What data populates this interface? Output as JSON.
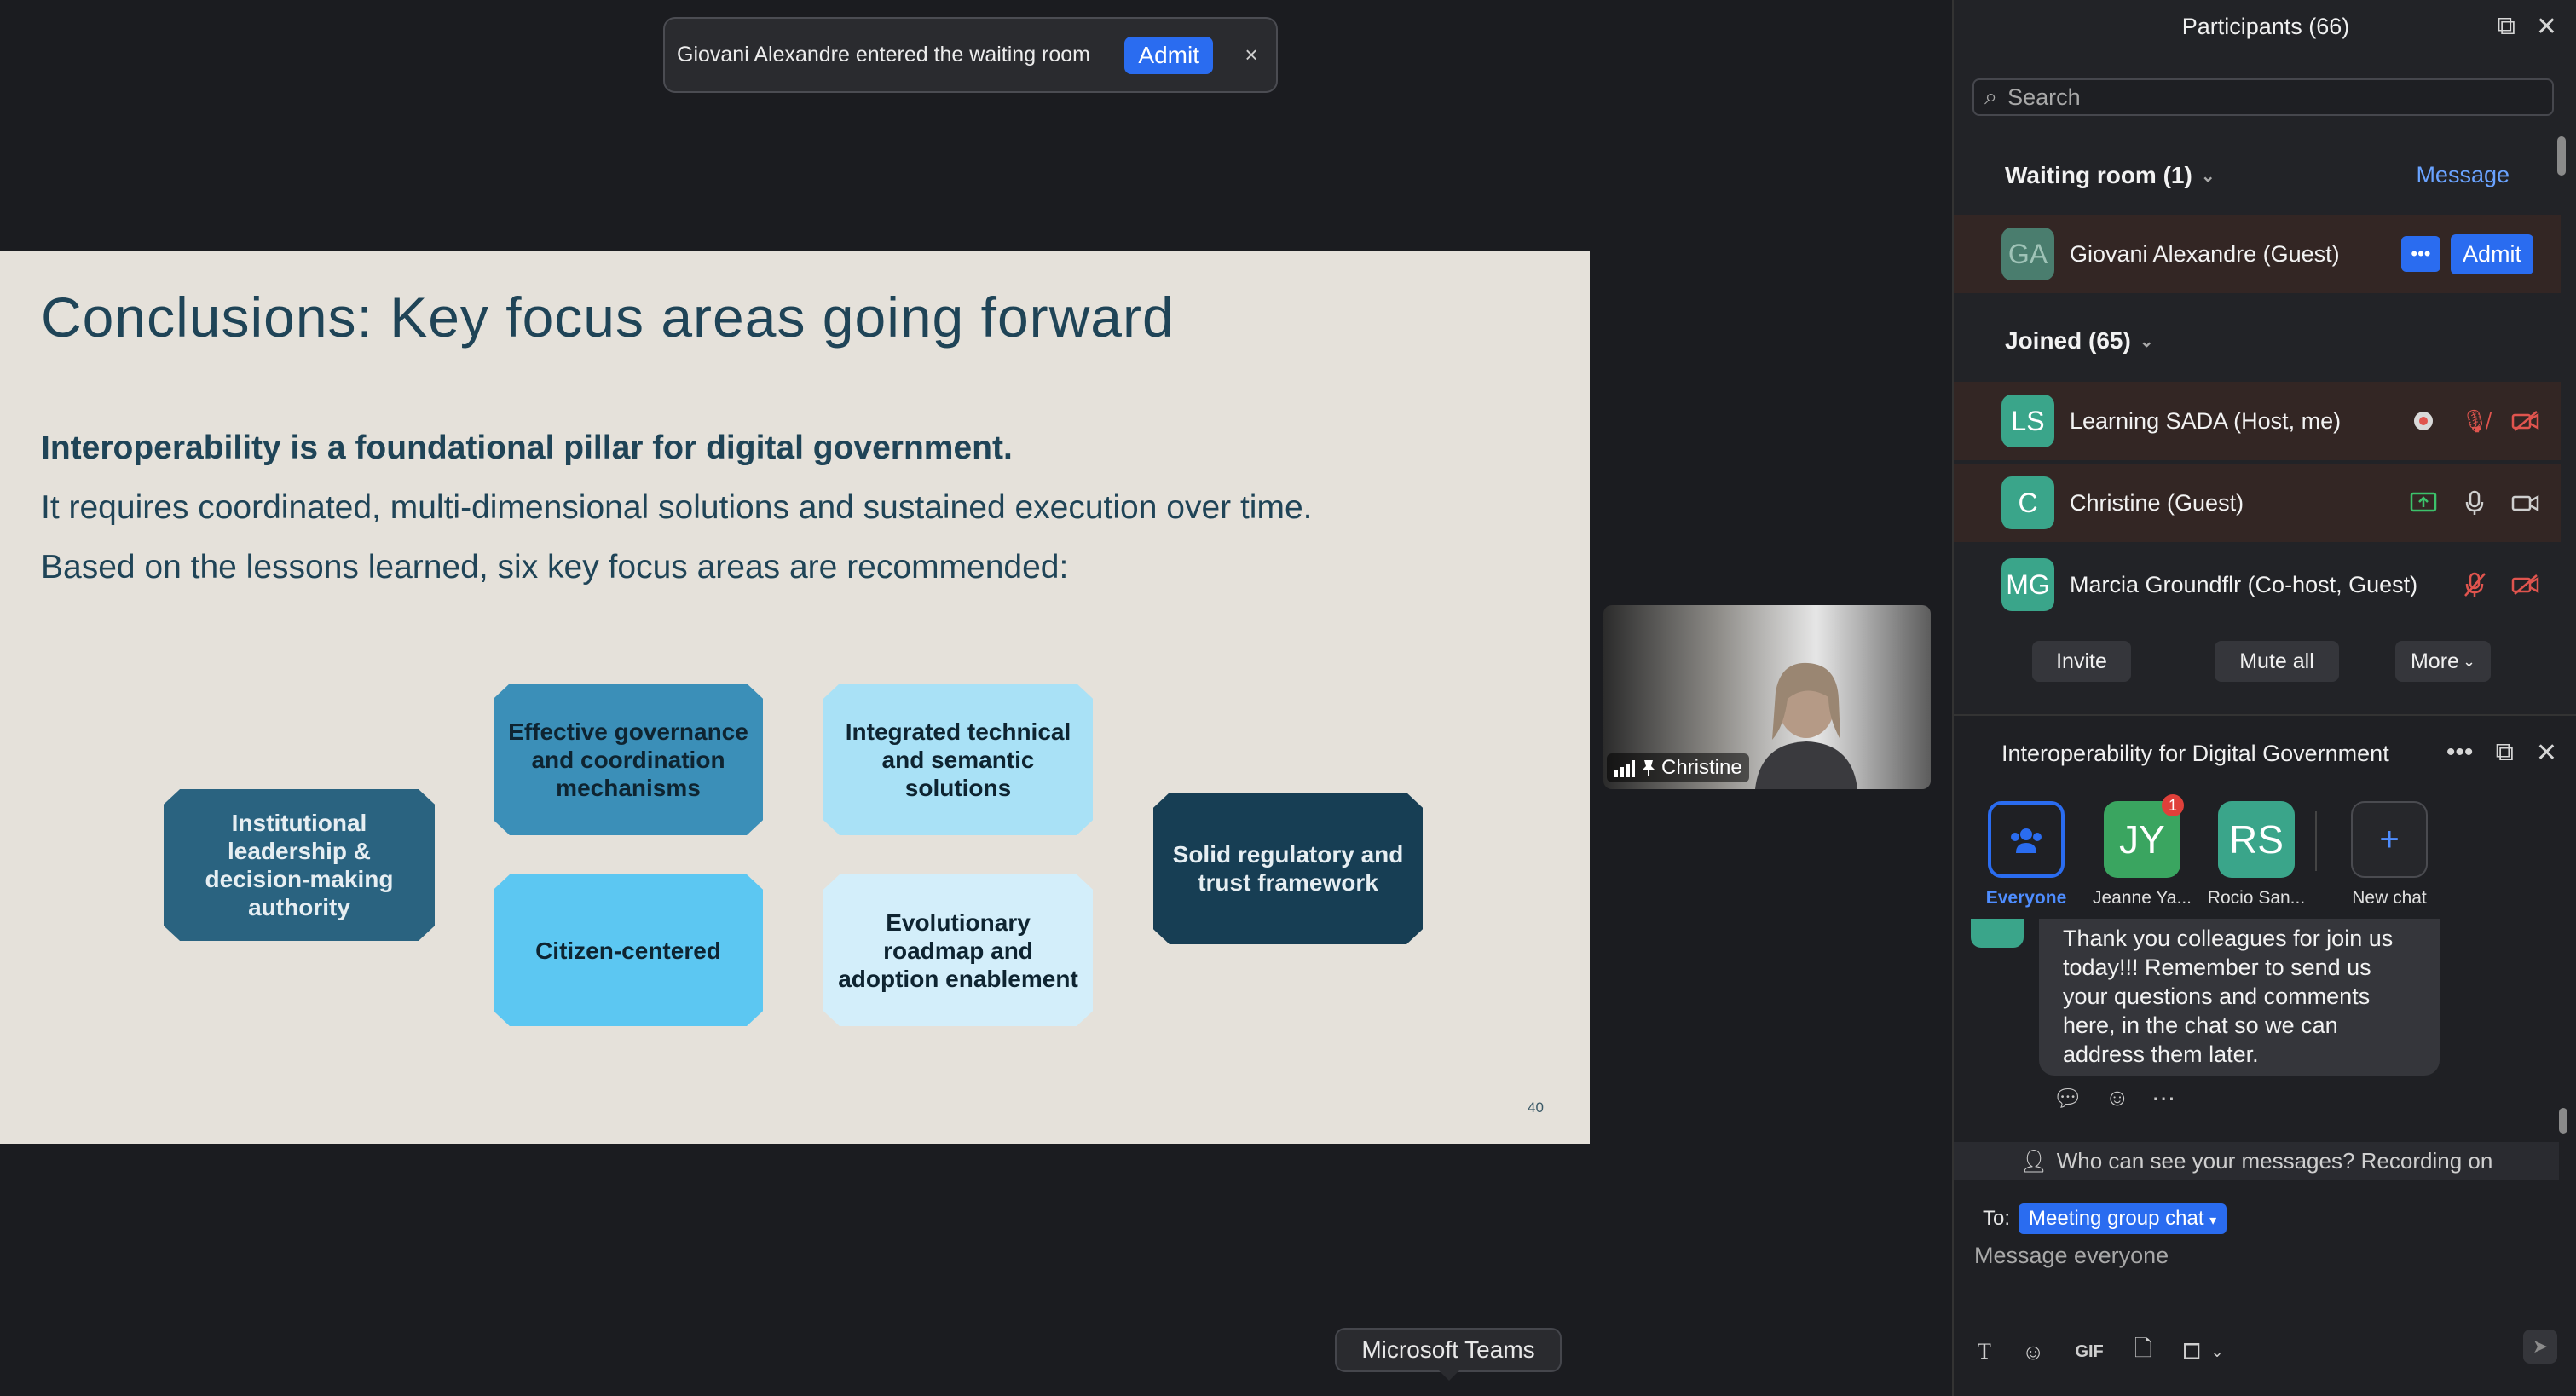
{
  "toast": {
    "message": "Giovani Alexandre entered the waiting room",
    "admit_label": "Admit",
    "close_glyph": "×"
  },
  "slide": {
    "title": "Conclusions: Key focus areas going forward",
    "line1": "Interoperability is a foundational pillar for digital government.",
    "line2": "It requires coordinated, multi-dimensional solutions and sustained execution over time.",
    "line3": "Based on the lessons learned, six key focus areas are recommended:",
    "boxes": [
      "Institutional leadership & decision-making authority",
      "Effective governance and coordination mechanisms",
      "Citizen-centered",
      "Integrated technical and semantic solutions",
      "Evolutionary roadmap and adoption enablement",
      "Solid regulatory and trust framework"
    ],
    "page_number": "40"
  },
  "video": {
    "name": "Christine"
  },
  "taskbar_label": "Microsoft Teams",
  "participants": {
    "title": "Participants (66)",
    "search_placeholder": "Search",
    "waiting_title": "Waiting room (1)",
    "message_link": "Message",
    "waiting": [
      {
        "initials": "GA",
        "name": "Giovani Alexandre (Guest)",
        "color": "#4a7d6e",
        "action": "Admit"
      }
    ],
    "joined_title": "Joined (65)",
    "joined": [
      {
        "initials": "LS",
        "name": "Learning SADA (Host, me)",
        "color": "#3aa58a"
      },
      {
        "initials": "C",
        "name": "Christine (Guest)",
        "color": "#3aa58a"
      },
      {
        "initials": "MG",
        "name": "Marcia Groundflr (Co-host, Guest)",
        "color": "#3aa58a"
      }
    ],
    "buttons": {
      "invite": "Invite",
      "mute_all": "Mute all",
      "more": "More"
    }
  },
  "chat": {
    "title": "Interoperability for Digital Government",
    "channels": [
      {
        "initials": "",
        "label": "Everyone",
        "color": "#2a6cf0"
      },
      {
        "initials": "JY",
        "label": "Jeanne Ya...",
        "color": "#3aa560",
        "badge": "1"
      },
      {
        "initials": "RS",
        "label": "Rocio San...",
        "color": "#3aa58a"
      },
      {
        "initials": "+",
        "label": "New chat",
        "color": "#26272b"
      }
    ],
    "message": "Thank you colleagues for join us today!!! Remember to send us your questions and comments here, in the chat so we can address them later.",
    "visibility": "Who can see your messages? Recording on",
    "to_label": "To:",
    "to_value": "Meeting group chat",
    "compose_placeholder": "Message everyone",
    "toolbar": [
      "text-format-icon",
      "emoji-icon",
      "gif-icon",
      "file-icon",
      "screenshot-icon"
    ]
  }
}
